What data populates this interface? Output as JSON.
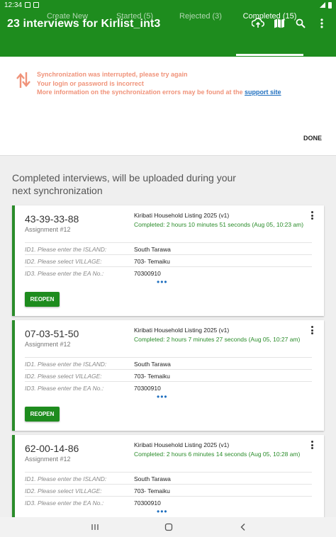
{
  "status": {
    "time": "12:34"
  },
  "app": {
    "title": "23 interviews for Kirlist_int3",
    "actions": [
      "sync-cloud-icon",
      "map-icon",
      "search-icon",
      "more-vert-icon"
    ]
  },
  "tabs": [
    {
      "label": "Create New",
      "active": false
    },
    {
      "label": "Started (5)",
      "active": false
    },
    {
      "label": "Rejected (3)",
      "active": false
    },
    {
      "label": "Completed (15)",
      "active": true
    }
  ],
  "sync": {
    "line1": "Synchronization was interrupted, please try again",
    "line2": "Your login or password is incorrect",
    "line3_prefix": "More information on the synchronization errors may be found at the",
    "link": "support site",
    "done": "DONE"
  },
  "section_title": "Completed interviews, will be uploaded during your next synchronization",
  "cards": [
    {
      "key": "43-39-33-88",
      "assignment": "Assignment #12",
      "questionnaire": "Kiribati Household Listing 2025 (v1)",
      "completed": "Completed: 2 hours 10 minutes 51 seconds (Aug 05, 10:23 am)",
      "rows": [
        {
          "label": "ID1. Please enter the ISLAND:",
          "value": "South Tarawa"
        },
        {
          "label": "ID2. Please select VILLAGE:",
          "value": "703- Temaiku"
        },
        {
          "label": "ID3. Please enter the EA No.:",
          "value": "70300910"
        }
      ],
      "more": "•••",
      "button": "REOPEN"
    },
    {
      "key": "07-03-51-50",
      "assignment": "Assignment #12",
      "questionnaire": "Kiribati Household Listing 2025 (v1)",
      "completed": "Completed: 2 hours 7 minutes 27 seconds (Aug 05, 10:27 am)",
      "rows": [
        {
          "label": "ID1. Please enter the ISLAND:",
          "value": "South Tarawa"
        },
        {
          "label": "ID2. Please select VILLAGE:",
          "value": "703- Temaiku"
        },
        {
          "label": "ID3. Please enter the EA No.:",
          "value": "70300910"
        }
      ],
      "more": "•••",
      "button": "REOPEN"
    },
    {
      "key": "62-00-14-86",
      "assignment": "Assignment #12",
      "questionnaire": "Kiribati Household Listing 2025 (v1)",
      "completed": "Completed: 2 hours 6 minutes 14 seconds (Aug 05, 10:28 am)",
      "rows": [
        {
          "label": "ID1. Please enter the ISLAND:",
          "value": "South Tarawa"
        },
        {
          "label": "ID2. Please select VILLAGE:",
          "value": "703- Temaiku"
        },
        {
          "label": "ID3. Please enter the EA No.:",
          "value": "70300910"
        }
      ],
      "more": "•••",
      "button": "REOPEN"
    }
  ],
  "colors": {
    "primary": "#1e8c1e",
    "error": "#f0937a",
    "link": "#1f6fbf"
  }
}
